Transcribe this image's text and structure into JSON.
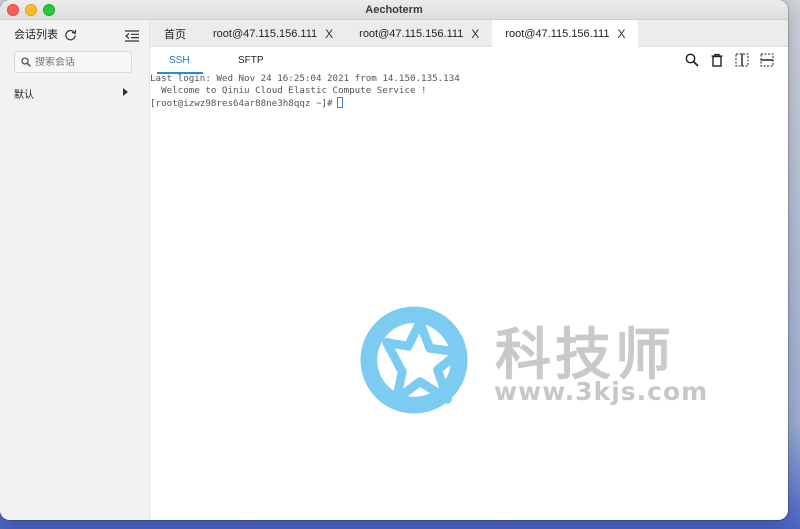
{
  "window": {
    "title": "Aechoterm"
  },
  "sidebar": {
    "title": "会话列表",
    "search_placeholder": "搜索会话",
    "groups": [
      {
        "label": "默认"
      }
    ]
  },
  "tabs": [
    {
      "label": "首页",
      "closable": false,
      "active": false
    },
    {
      "label": "root@47.115.156.111",
      "closable": true,
      "active": false
    },
    {
      "label": "root@47.115.156.111",
      "closable": true,
      "active": false
    },
    {
      "label": "root@47.115.156.111",
      "closable": true,
      "active": true
    }
  ],
  "close_glyph": "X",
  "subtabs": {
    "ssh": "SSH",
    "sftp": "SFTP",
    "active": "SSH"
  },
  "toolbar": {
    "icons": [
      "search-icon",
      "trash-icon",
      "split-vertical-icon",
      "split-horizontal-icon"
    ]
  },
  "terminal": {
    "lines": [
      "Last login: Wed Nov 24 16:25:04 2021 from 14.150.135.134",
      "  Welcome to Qiniu Cloud Elastic Compute Service !",
      "",
      "[root@izwz98res64ar88ne3h8qqz ~]#"
    ]
  },
  "watermark": {
    "title": "科技师",
    "url": "www.3kjs.com"
  },
  "colors": {
    "accent": "#1f79c4",
    "cursor": "#3d7fd6",
    "logo": "#7ccbf0"
  }
}
